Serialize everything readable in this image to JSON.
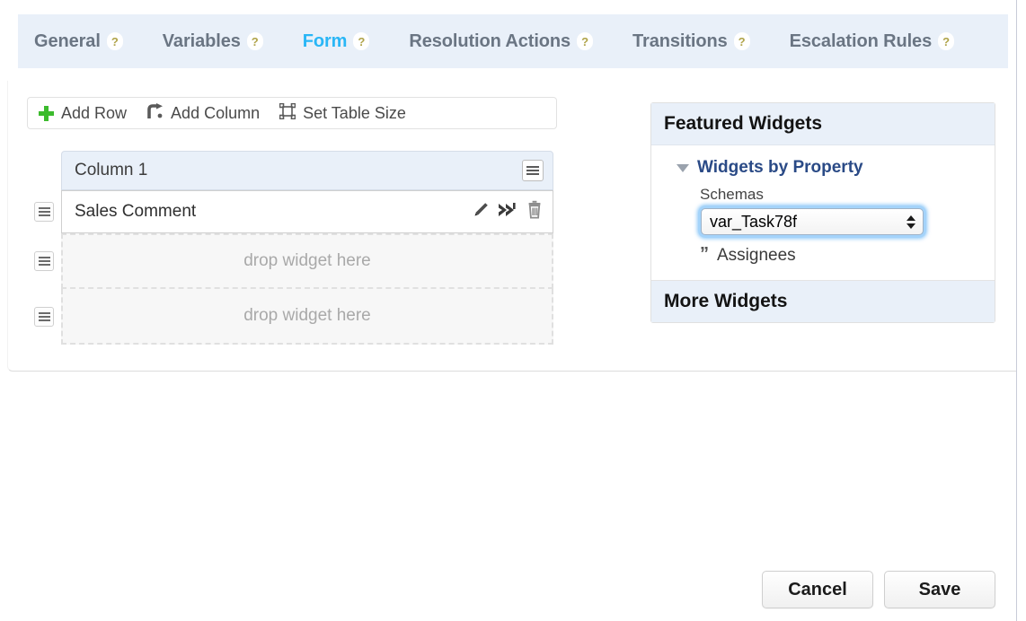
{
  "tabs": [
    {
      "label": "General",
      "help": "?",
      "active": false
    },
    {
      "label": "Variables",
      "help": "?",
      "active": false
    },
    {
      "label": "Form",
      "help": "?",
      "active": true
    },
    {
      "label": "Resolution Actions",
      "help": "?",
      "active": false
    },
    {
      "label": "Transitions",
      "help": "?",
      "active": false
    },
    {
      "label": "Escalation Rules",
      "help": "?",
      "active": false
    }
  ],
  "toolbar": {
    "add_row_label": "Add Row",
    "add_column_label": "Add Column",
    "set_table_size_label": "Set Table Size",
    "add_row_icon": "plus-icon",
    "add_column_icon": "add-column-icon",
    "set_table_size_icon": "resize-icon"
  },
  "form_table": {
    "column_header": "Column 1",
    "column_menu_icon": "hamburger-menu-icon",
    "rows": [
      {
        "type": "filled",
        "label": "Sales Comment",
        "actions": [
          "pencil-icon",
          "move-icon",
          "trash-icon"
        ],
        "handle_icon": "drag-handle-icon"
      },
      {
        "type": "empty",
        "label": "drop widget here",
        "handle_icon": "drag-handle-icon"
      },
      {
        "type": "empty",
        "label": "drop widget here",
        "handle_icon": "drag-handle-icon"
      }
    ]
  },
  "widget_panel": {
    "featured_header": "Featured Widgets",
    "more_header": "More Widgets",
    "group": {
      "label": "Widgets by Property",
      "caret_icon": "caret-down-icon",
      "field_label": "Schemas",
      "select_value": "var_Task78f",
      "select_stepper_icon": "stepper-arrows-icon",
      "items": [
        {
          "label": "Assignees",
          "icon": "quote-icon"
        }
      ]
    }
  },
  "footer": {
    "cancel_label": "Cancel",
    "save_label": "Save"
  },
  "colors": {
    "tab_bar_bg": "#e9f0f9",
    "active_tab": "#29b6f6",
    "inactive_tab": "#6a7583",
    "help_badge_text": "#b0a44a",
    "plus_green": "#3cbb2d",
    "group_link": "#2a4a86",
    "focus_ring": "#5aaff5",
    "placeholder_text": "#a9a9a9"
  }
}
